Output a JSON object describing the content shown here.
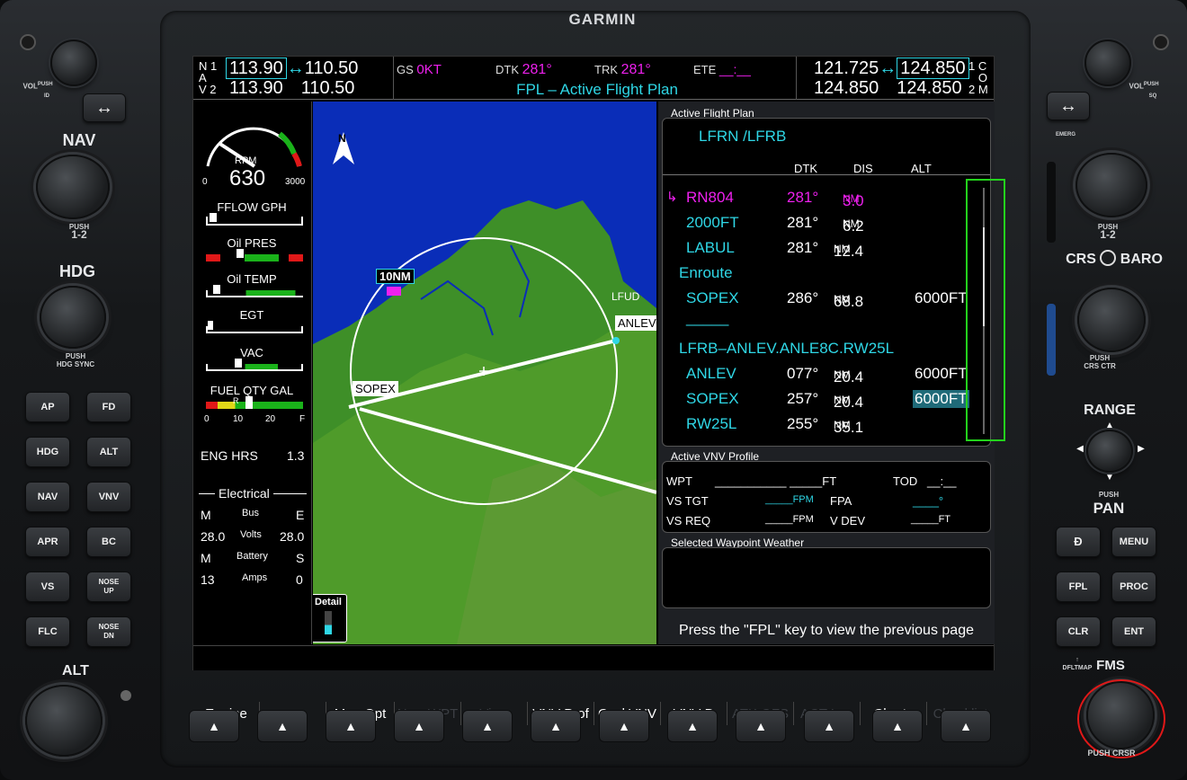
{
  "brand": "GARMIN",
  "left_panel": {
    "vol_label": "VOL",
    "vol_push": "PUSH",
    "vol_id": "ID",
    "nav_label": "NAV",
    "nav_push": "PUSH",
    "nav_push2": "1-2",
    "hdg_label": "HDG",
    "hdg_push": "PUSH",
    "hdg_push2": "HDG SYNC",
    "alt_label": "ALT",
    "buttons": [
      "AP",
      "FD",
      "HDG",
      "ALT",
      "NAV",
      "VNV",
      "APR",
      "BC",
      "VS",
      "NOSE\nUP",
      "FLC",
      "NOSE\nDN"
    ]
  },
  "right_panel": {
    "vol_label": "VOL",
    "vol_push": "PUSH",
    "vol_sq": "SQ",
    "emerg": "EMERG",
    "crs_push": "PUSH",
    "crs_push2": "1-2",
    "crs_label": "CRS",
    "baro_label": "BARO",
    "crs_ctr_push": "PUSH",
    "crs_ctr": "CRS CTR",
    "range": "RANGE",
    "range_push": "PUSH",
    "pan": "PAN",
    "buttons": [
      "Ð",
      "MENU",
      "FPL",
      "PROC",
      "CLR",
      "ENT"
    ],
    "dflt_map": "DFLTMAP",
    "fms": "FMS",
    "fms_push": "PUSH CRSR"
  },
  "top_bar": {
    "nav_n": "N",
    "nav_a": "A",
    "nav_v": "V",
    "nav_1": "1",
    "nav_2": "2",
    "nav1_active": "113.90",
    "nav1_standby": "110.50",
    "nav2_active": "113.90",
    "nav2_standby": "110.50",
    "gs_label": "GS",
    "gs_value": "0KT",
    "dtk_label": "DTK",
    "dtk_value": "281°",
    "trk_label": "TRK",
    "trk_value": "281°",
    "ete_label": "ETE",
    "ete_value": "__:__",
    "title": "FPL – Active Flight Plan",
    "com1_active": "121.725",
    "com1_standby": "124.850",
    "com2_active": "124.850",
    "com2_standby": "124.850",
    "com_c": "C",
    "com_o": "O",
    "com_m": "M",
    "com_1": "1",
    "com_2": "2"
  },
  "engine": {
    "rpm_label": "RPM",
    "rpm_value": "630",
    "rpm_min": "0",
    "rpm_max": "3000",
    "fflow": "FFLOW GPH",
    "oil_pres": "Oil PRES",
    "oil_temp": "Oil TEMP",
    "egt": "EGT",
    "vac": "VAC",
    "fuel_qty": "FUEL QTY GAL",
    "fuel_ticks": [
      "0",
      "10",
      "20",
      "F"
    ],
    "fuel_marker": "R",
    "eng_hrs_label": "ENG HRS",
    "eng_hrs_value": "1.3",
    "electrical": "Electrical",
    "bus_m": "M",
    "bus_label": "Bus",
    "bus_e": "E",
    "volts_left": "28.0",
    "volts_label": "Volts",
    "volts_right": "28.0",
    "bat_m": "M",
    "bat_label": "Battery",
    "bat_s": "S",
    "amps_left": "13",
    "amps_label": "Amps",
    "amps_right": "0"
  },
  "map": {
    "north": "N",
    "range_label": "10NM",
    "wpt_sopex": "SOPEX",
    "wpt_anlev": "ANLEV",
    "wpt_lfud": "LFUD",
    "detail": "Detail"
  },
  "flight_plan": {
    "section_title": "Active Flight Plan",
    "route": "LFRN /LFRB",
    "col_dtk": "DTK",
    "col_dis": "DIS",
    "col_alt": "ALT",
    "rows": [
      {
        "wpt": "RN804",
        "dtk": "281°",
        "dis": "3.0",
        "unit": "NM",
        "alt": ""
      },
      {
        "wpt": "2000FT",
        "dtk": "281°",
        "dis": "6.2",
        "unit": "NM",
        "alt": ""
      },
      {
        "wpt": "LABUL",
        "dtk": "281°",
        "dis": "12.4",
        "unit": "NM",
        "alt": ""
      },
      {
        "wpt": "Enroute",
        "dtk": "",
        "dis": "",
        "unit": "",
        "alt": ""
      },
      {
        "wpt": "SOPEX",
        "dtk": "286°",
        "dis": "68.8",
        "unit": "NM",
        "alt": "6000FT"
      },
      {
        "wpt": "_____",
        "dtk": "",
        "dis": "",
        "unit": "",
        "alt": ""
      },
      {
        "wpt": "LFRB–ANLEV.ANLE8C.RW25L",
        "dtk": "",
        "dis": "",
        "unit": "",
        "alt": ""
      },
      {
        "wpt": "ANLEV",
        "dtk": "077°",
        "dis": "20.4",
        "unit": "NM",
        "alt": "6000FT"
      },
      {
        "wpt": "SOPEX",
        "dtk": "257°",
        "dis": "20.4",
        "unit": "NM",
        "alt": "6000FT"
      },
      {
        "wpt": "RW25L",
        "dtk": "255°",
        "dis": "35.1",
        "unit": "NM",
        "alt": ""
      }
    ]
  },
  "vnv": {
    "title": "Active VNV Profile",
    "wpt_label": "WPT",
    "wpt_value": "___________ _____FT",
    "tod_label": "TOD",
    "tod_value": "__:__",
    "vstgt_label": "VS TGT",
    "vstgt_value": "_____FPM",
    "fpa_label": "FPA",
    "fpa_value": "____°",
    "vsreq_label": "VS REQ",
    "vsreq_value": "_____FPM",
    "vdev_label": "V DEV",
    "vdev_value": "_____FT"
  },
  "weather": {
    "title": "Selected Waypoint Weather"
  },
  "footer_msg": "Press the \"FPL\" key to view the previous page",
  "softkeys": [
    "Engine",
    "",
    "Map Opt",
    "New WPT",
    "View",
    "VNV Prof",
    "Cncl VNV",
    "VNV Ð",
    "ATK OFS",
    "ACT Leg",
    "Charts",
    "Checklist"
  ],
  "softkey_arrow": "▲"
}
